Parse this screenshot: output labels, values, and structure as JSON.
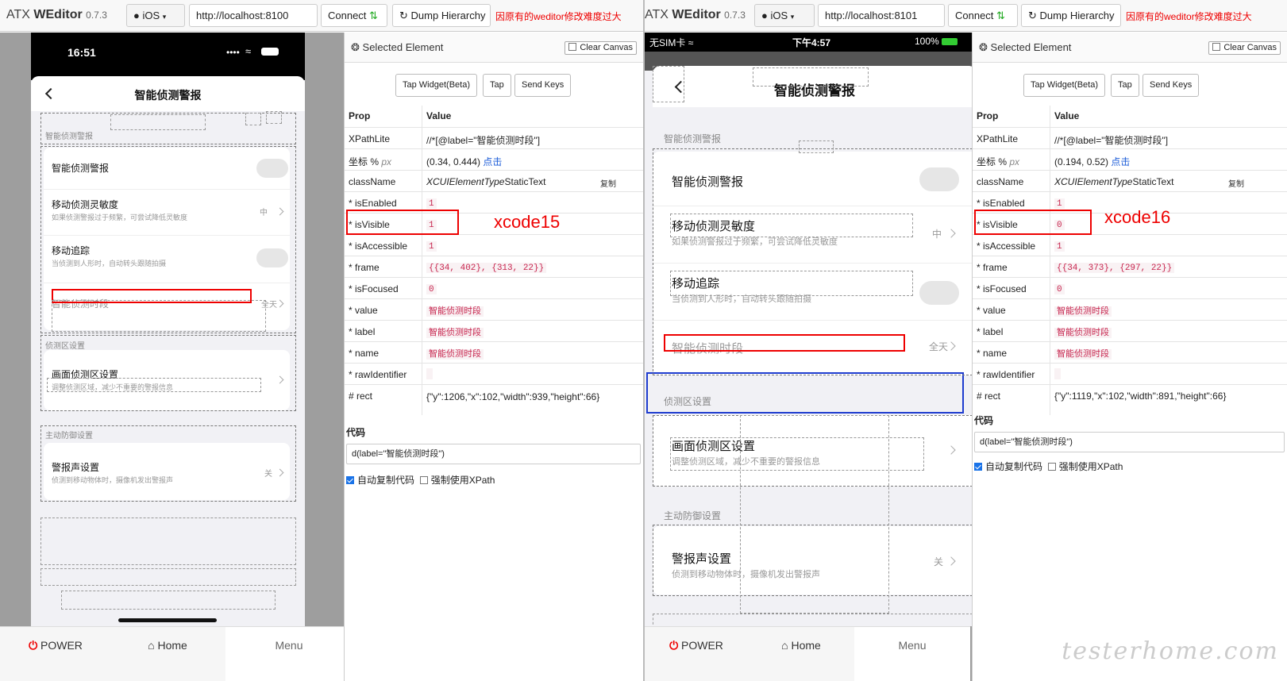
{
  "left": {
    "brand": {
      "name": "ATX",
      "strong": "WEditor",
      "version": "0.7.3"
    },
    "toolbar": {
      "platform": "iOS",
      "url": "http://localhost:8100",
      "connect": "Connect",
      "dump": "Dump Hierarchy",
      "warning": "因原有的weditor修改难度过大"
    },
    "device": {
      "time": "16:51",
      "title": "智能侦测警报",
      "section1": "智能侦测警报",
      "rows": [
        {
          "title": "智能侦测警报",
          "sub": "",
          "value": ""
        },
        {
          "title": "移动侦测灵敏度",
          "sub": "如果侦测警报过于频繁，可尝试降低灵敏度",
          "value": "中"
        },
        {
          "title": "移动追踪",
          "sub": "当侦测到人形时，自动转头跟随拍摄",
          "value": ""
        },
        {
          "title": "智能侦测时段",
          "sub": "",
          "value": "全天"
        }
      ],
      "section2": "侦测区设置",
      "row_area": {
        "title": "画面侦测区设置",
        "sub": "调整侦测区域，减少不重要的警报信息"
      },
      "section3": "主动防御设置",
      "row_alarm": {
        "title": "警报声设置",
        "sub": "侦测到移动物体时，摄像机发出警报声",
        "value": "关"
      }
    },
    "bottom": {
      "power": "POWER",
      "home": "Home",
      "menu": "Menu"
    },
    "inspector": {
      "title": "Selected Element",
      "clear": "Clear Canvas",
      "actions": [
        "Tap Widget(Beta)",
        "Tap",
        "Send Keys"
      ],
      "header": {
        "prop": "Prop",
        "value": "Value"
      },
      "xpath": {
        "k": "XPathLite",
        "v": "//*[@label=\"智能侦测时段\"]"
      },
      "coord": {
        "k": "坐标 %",
        "unit": "px",
        "v": "(0.34, 0.444)",
        "link": "点击"
      },
      "classname": {
        "k": "className",
        "pre": "XCUIElementType",
        "post": "StaticText",
        "copy": "复制"
      },
      "props": [
        {
          "k": "* isEnabled",
          "v": "1"
        },
        {
          "k": "* isVisible",
          "v": "1"
        },
        {
          "k": "* isAccessible",
          "v": "1"
        },
        {
          "k": "* frame",
          "v": "{{34, 402}, {313, 22}}"
        },
        {
          "k": "* isFocused",
          "v": "0"
        },
        {
          "k": "* value",
          "v": "智能侦测时段"
        },
        {
          "k": "* label",
          "v": "智能侦测时段"
        },
        {
          "k": "* name",
          "v": "智能侦测时段"
        },
        {
          "k": "* rawIdentifier",
          "v": ""
        }
      ],
      "rect": {
        "k": "# rect",
        "v": "{\"y\":1206,\"x\":102,\"width\":939,\"height\":66}"
      },
      "code_label": "代码",
      "code": "d(label=\"智能侦测时段\")",
      "auto_copy": "自动复制代码",
      "force_xpath": "强制使用XPath",
      "annotation": "xcode15"
    }
  },
  "right": {
    "brand": {
      "name": "ATX",
      "strong": "WEditor",
      "version": "0.7.3"
    },
    "toolbar": {
      "platform": "iOS",
      "url": "http://localhost:8101",
      "connect": "Connect",
      "dump": "Dump Hierarchy",
      "warning": "因原有的weditor修改难度过大"
    },
    "device": {
      "carrier": "无SIM卡",
      "time": "下午4:57",
      "battery": "100%",
      "title": "智能侦测警报",
      "section1": "智能侦测警报",
      "rows": [
        {
          "title": "智能侦测警报",
          "sub": "",
          "value": ""
        },
        {
          "title": "移动侦测灵敏度",
          "sub": "如果侦测警报过于频繁，可尝试降低灵敏度",
          "value": "中"
        },
        {
          "title": "移动追踪",
          "sub": "当侦测到人形时，自动转头跟随拍摄",
          "value": ""
        },
        {
          "title": "智能侦测时段",
          "sub": "",
          "value": "全天"
        }
      ],
      "section2": "侦测区设置",
      "row_area": {
        "title": "画面侦测区设置",
        "sub": "调整侦测区域，减少不重要的警报信息"
      },
      "section3": "主动防御设置",
      "row_alarm": {
        "title": "警报声设置",
        "sub": "侦测到移动物体时，摄像机发出警报声",
        "value": "关"
      }
    },
    "bottom": {
      "power": "POWER",
      "home": "Home",
      "menu": "Menu"
    },
    "inspector": {
      "title": "Selected Element",
      "clear": "Clear Canvas",
      "actions": [
        "Tap Widget(Beta)",
        "Tap",
        "Send Keys"
      ],
      "header": {
        "prop": "Prop",
        "value": "Value"
      },
      "xpath": {
        "k": "XPathLite",
        "v": "//*[@label=\"智能侦测时段\"]"
      },
      "coord": {
        "k": "坐标 %",
        "unit": "px",
        "v": "(0.194, 0.52)",
        "link": "点击"
      },
      "classname": {
        "k": "className",
        "pre": "XCUIElementType",
        "post": "StaticText",
        "copy": "复制"
      },
      "props": [
        {
          "k": "* isEnabled",
          "v": "1"
        },
        {
          "k": "* isVisible",
          "v": "0"
        },
        {
          "k": "* isAccessible",
          "v": "1"
        },
        {
          "k": "* frame",
          "v": "{{34, 373}, {297, 22}}"
        },
        {
          "k": "* isFocused",
          "v": "0"
        },
        {
          "k": "* value",
          "v": "智能侦测时段"
        },
        {
          "k": "* label",
          "v": "智能侦测时段"
        },
        {
          "k": "* name",
          "v": "智能侦测时段"
        },
        {
          "k": "* rawIdentifier",
          "v": ""
        }
      ],
      "rect": {
        "k": "# rect",
        "v": "{\"y\":1119,\"x\":102,\"width\":891,\"height\":66}"
      },
      "code_label": "代码",
      "code": "d(label=\"智能侦测时段\")",
      "auto_copy": "自动复制代码",
      "force_xpath": "强制使用XPath",
      "annotation": "xcode16"
    }
  },
  "watermark": "testerhome.com",
  "colors": {
    "highlight_red": "#e00000",
    "highlight_blue": "#1e3ccf",
    "link": "#1a5bd8",
    "code": "#c7254e"
  },
  "icons": [
    "back-chevron-icon",
    "chevron-right-icon",
    "power-icon",
    "home-icon",
    "refresh-icon",
    "wifi-icon",
    "battery-icon",
    "apple-icon",
    "connect-icon",
    "record-icon"
  ]
}
